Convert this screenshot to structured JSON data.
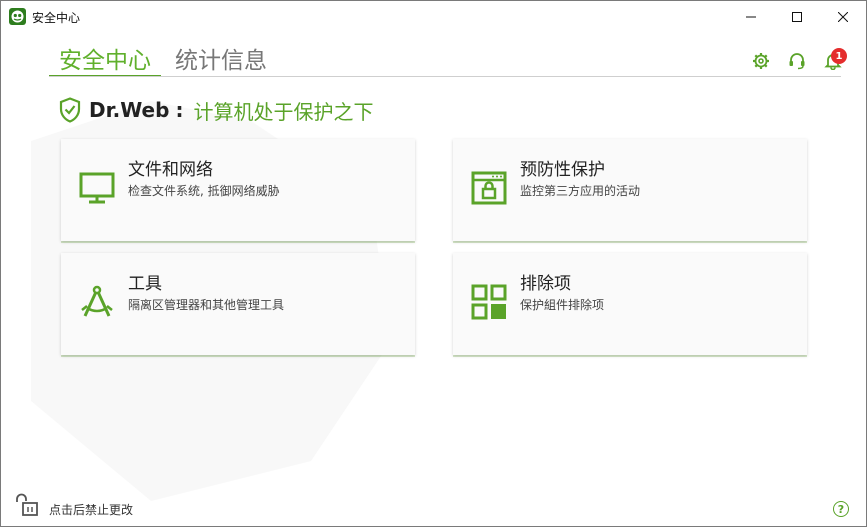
{
  "window": {
    "title": "安全中心"
  },
  "tabs": [
    {
      "label": "安全中心",
      "active": true
    },
    {
      "label": "统计信息",
      "active": false
    }
  ],
  "toolbar": {
    "settings_icon": "gear-icon",
    "support_icon": "headset-icon",
    "notifications_icon": "bell-icon",
    "notifications_count": "1"
  },
  "status": {
    "brand": "Dr.Web",
    "separator": ":",
    "message": "计算机处于保护之下"
  },
  "cards": [
    {
      "title": "文件和网络",
      "subtitle": "检查文件系统, 抵御网络威胁",
      "icon": "monitor-icon"
    },
    {
      "title": "预防性保护",
      "subtitle": "监控第三方应用的活动",
      "icon": "app-lock-icon"
    },
    {
      "title": "工具",
      "subtitle": "隔离区管理器和其他管理工具",
      "icon": "compass-tool-icon"
    },
    {
      "title": "排除项",
      "subtitle": "保护組件排除项",
      "icon": "grid-icon"
    }
  ],
  "footer": {
    "lock_text": "点击后禁止更改",
    "help_label": "?"
  },
  "colors": {
    "accent": "#5aa329",
    "badge": "#e42d2d"
  }
}
